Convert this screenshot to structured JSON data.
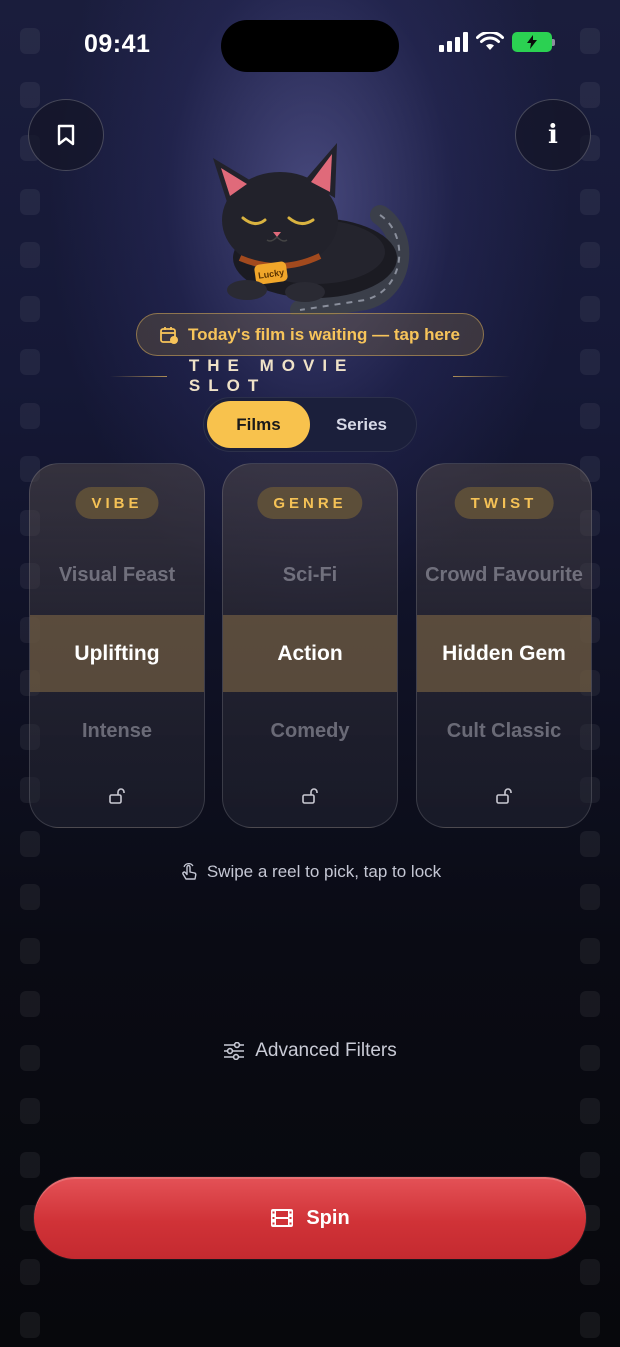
{
  "status_bar": {
    "time": "09:41"
  },
  "banner": {
    "text": "Today's film is waiting — tap here"
  },
  "mascot": {
    "tag_text": "Lucky"
  },
  "title": "THE MOVIE SLOT",
  "mode_toggle": {
    "options": [
      "Films",
      "Series"
    ],
    "selected": "Films"
  },
  "reels": [
    {
      "label": "VIBE",
      "above": "Visual Feast",
      "selected": "Uplifting",
      "below": "Intense",
      "locked": false
    },
    {
      "label": "GENRE",
      "above": "Sci-Fi",
      "selected": "Action",
      "below": "Comedy",
      "locked": false
    },
    {
      "label": "TWIST",
      "above": "Crowd Favourite",
      "selected": "Hidden Gem",
      "below": "Cult Classic",
      "locked": false
    }
  ],
  "hint": "Swipe a reel to pick, tap to lock",
  "advanced_filters": "Advanced Filters",
  "spin_button": "Spin",
  "colors": {
    "accent": "#f8c24d",
    "spin": "#d03237",
    "battery": "#2bd152"
  },
  "icons": {
    "top_left": "bookmark-icon",
    "top_right": "info-icon",
    "banner": "calendar-check-icon",
    "hint": "tap-gesture-icon",
    "filters": "sliders-icon",
    "spin": "film-icon",
    "lock": "unlock-icon"
  }
}
